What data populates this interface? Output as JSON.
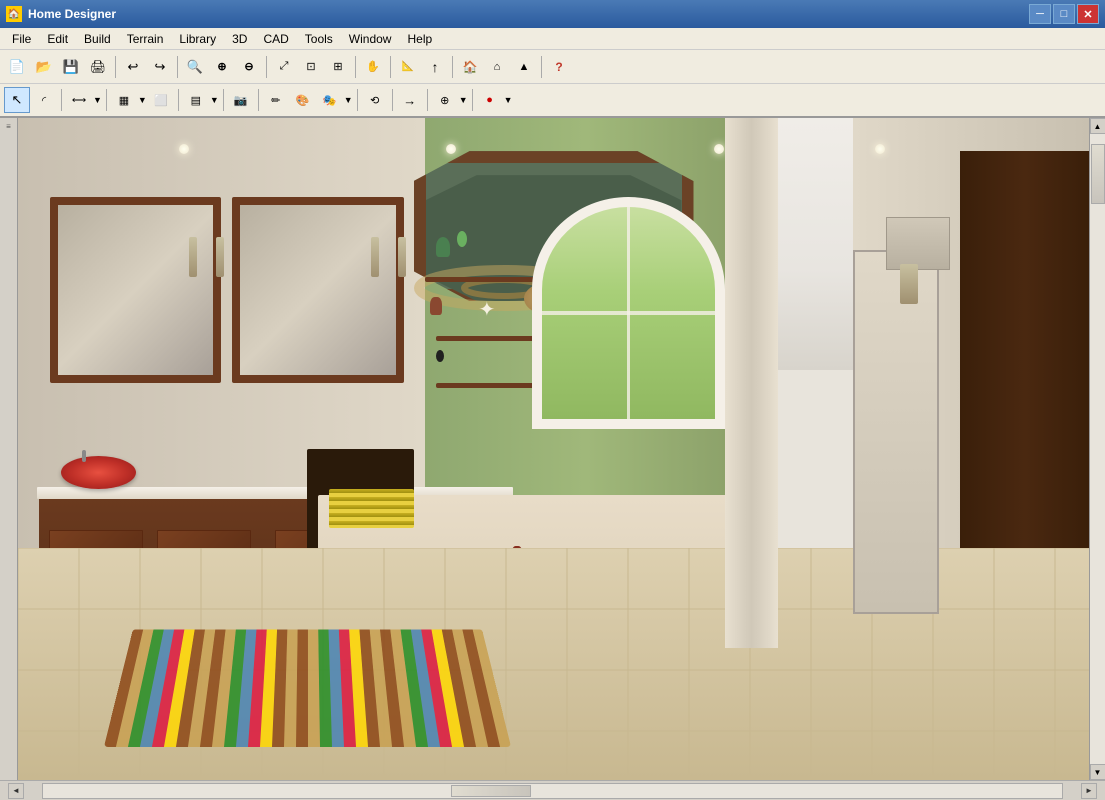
{
  "app": {
    "title": "Home Designer",
    "icon": "🏠"
  },
  "titlebar": {
    "title": "Home Designer",
    "minimize_label": "─",
    "maximize_label": "□",
    "close_label": "✕"
  },
  "menubar": {
    "items": [
      {
        "id": "file",
        "label": "File"
      },
      {
        "id": "edit",
        "label": "Edit"
      },
      {
        "id": "build",
        "label": "Build"
      },
      {
        "id": "terrain",
        "label": "Terrain"
      },
      {
        "id": "library",
        "label": "Library"
      },
      {
        "id": "3d",
        "label": "3D"
      },
      {
        "id": "cad",
        "label": "CAD"
      },
      {
        "id": "tools",
        "label": "Tools"
      },
      {
        "id": "window",
        "label": "Window"
      },
      {
        "id": "help",
        "label": "Help"
      }
    ]
  },
  "toolbar1": {
    "buttons": [
      {
        "id": "new",
        "icon": "📄",
        "label": "New"
      },
      {
        "id": "open",
        "icon": "📂",
        "label": "Open"
      },
      {
        "id": "save",
        "icon": "💾",
        "label": "Save"
      },
      {
        "id": "print",
        "icon": "🖨",
        "label": "Print"
      },
      {
        "id": "undo",
        "icon": "↩",
        "label": "Undo"
      },
      {
        "id": "redo",
        "icon": "↪",
        "label": "Redo"
      },
      {
        "id": "zoom-in-glass",
        "icon": "🔍",
        "label": "Zoom In"
      },
      {
        "id": "zoom-in",
        "icon": "+",
        "label": "Zoom In Alt"
      },
      {
        "id": "zoom-out",
        "icon": "−",
        "label": "Zoom Out"
      },
      {
        "id": "fill-window",
        "icon": "⊡",
        "label": "Fill Window"
      },
      {
        "id": "zoom-box",
        "icon": "⊞",
        "label": "Zoom Box"
      },
      {
        "id": "pan",
        "icon": "✋",
        "label": "Pan"
      },
      {
        "id": "marker",
        "icon": "📍",
        "label": "Marker"
      },
      {
        "id": "arrow-up",
        "icon": "↑",
        "label": "Arrow Up"
      },
      {
        "id": "stairs",
        "icon": "🪜",
        "label": "Stairs"
      },
      {
        "id": "question",
        "icon": "?",
        "label": "Help"
      }
    ]
  },
  "toolbar2": {
    "buttons": [
      {
        "id": "select",
        "icon": "↖",
        "label": "Select"
      },
      {
        "id": "arc-select",
        "icon": "◜",
        "label": "Arc Select"
      },
      {
        "id": "dimension",
        "icon": "⟷",
        "label": "Dimension"
      },
      {
        "id": "wall-type",
        "icon": "▦",
        "label": "Wall Type"
      },
      {
        "id": "room",
        "icon": "⬜",
        "label": "Room"
      },
      {
        "id": "stairs2",
        "icon": "▤",
        "label": "Stairs 2"
      },
      {
        "id": "camera",
        "icon": "📷",
        "label": "Camera"
      },
      {
        "id": "pencil",
        "icon": "✏",
        "label": "Pencil"
      },
      {
        "id": "colors",
        "icon": "🎨",
        "label": "Colors"
      },
      {
        "id": "material",
        "icon": "🎭",
        "label": "Material"
      },
      {
        "id": "transform",
        "icon": "⟲",
        "label": "Transform"
      },
      {
        "id": "arrow-right",
        "icon": "→",
        "label": "Arrow Right"
      },
      {
        "id": "cursor-plus",
        "icon": "⊕",
        "label": "Cursor Plus"
      },
      {
        "id": "record",
        "icon": "●",
        "label": "Record"
      }
    ]
  },
  "statusbar": {
    "text": ""
  },
  "scene": {
    "description": "3D bathroom render with luxury fixtures"
  }
}
